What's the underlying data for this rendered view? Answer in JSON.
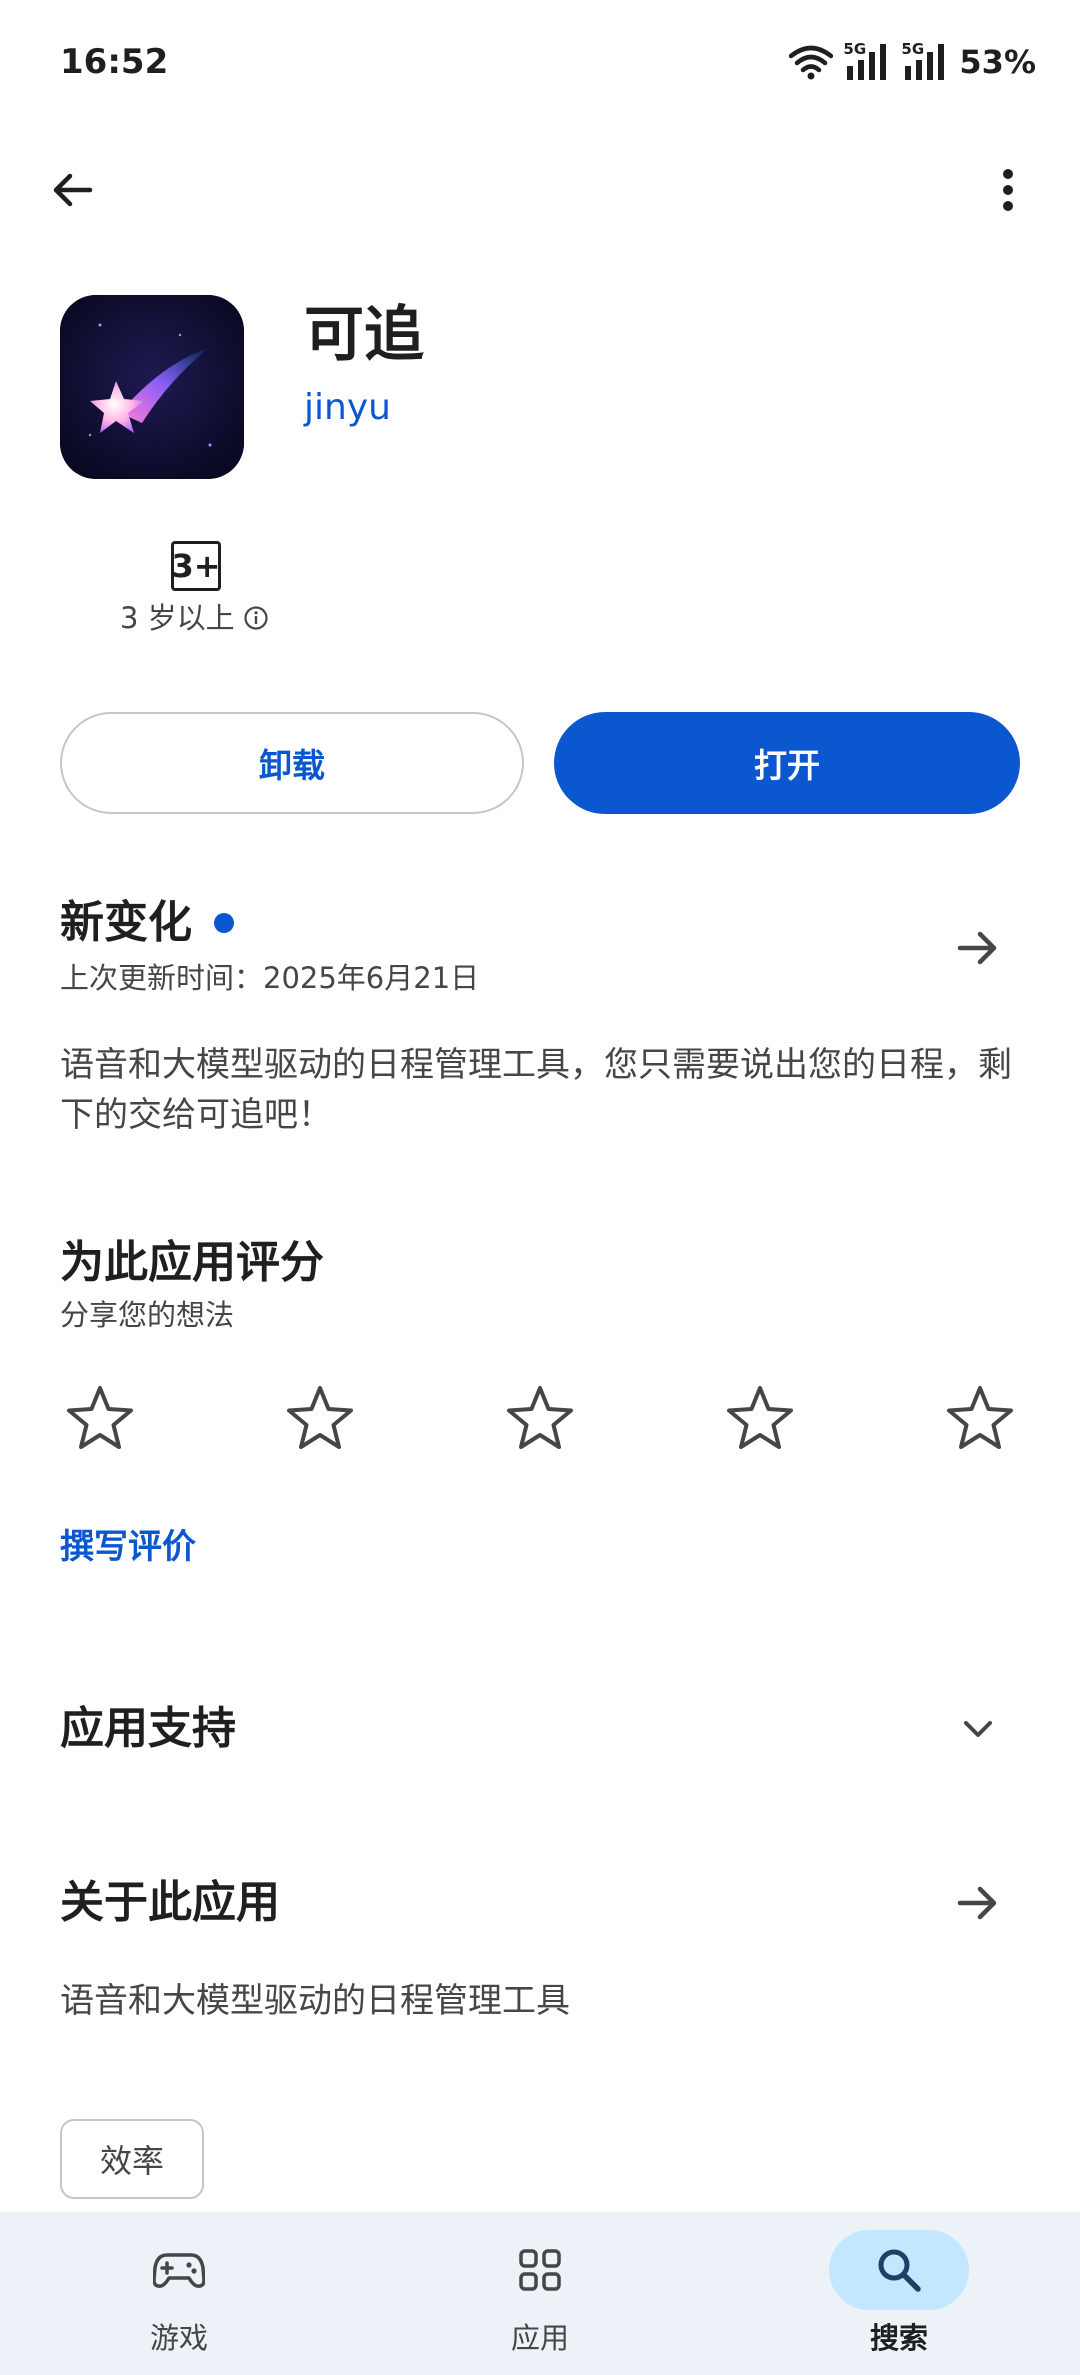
{
  "status_bar": {
    "time": "16:52",
    "network_1": "5G",
    "network_2": "5G",
    "battery": "53%"
  },
  "top_bar": {
    "back_icon": "arrow-left-icon",
    "menu_icon": "more-vert-icon"
  },
  "app": {
    "title": "可追",
    "developer": "jinyu",
    "icon": "app-logo-shooting-star"
  },
  "rating": {
    "badge": "3+",
    "label": "3 岁以上"
  },
  "actions": {
    "uninstall": "卸载",
    "open": "打开"
  },
  "whats_new": {
    "title": "新变化",
    "updated": "上次更新时间：2025年6月21日",
    "body": "语音和大模型驱动的日程管理工具，您只需要说出您的日程，剩下的交给可追吧！"
  },
  "rate_app": {
    "title": "为此应用评分",
    "subtitle": "分享您的想法",
    "stars": 5,
    "write_review": "撰写评价"
  },
  "support": {
    "title": "应用支持"
  },
  "about": {
    "title": "关于此应用",
    "body": "语音和大模型驱动的日程管理工具",
    "tag": "效率"
  },
  "bottom_nav": {
    "items": [
      {
        "label": "游戏",
        "icon": "gamepad-icon"
      },
      {
        "label": "应用",
        "icon": "apps-grid-icon"
      },
      {
        "label": "搜索",
        "icon": "search-icon",
        "active": true
      }
    ]
  },
  "colors": {
    "accent": "#0b57d0",
    "nav_bg": "#edf1f8",
    "nav_active": "#c2e7ff"
  }
}
